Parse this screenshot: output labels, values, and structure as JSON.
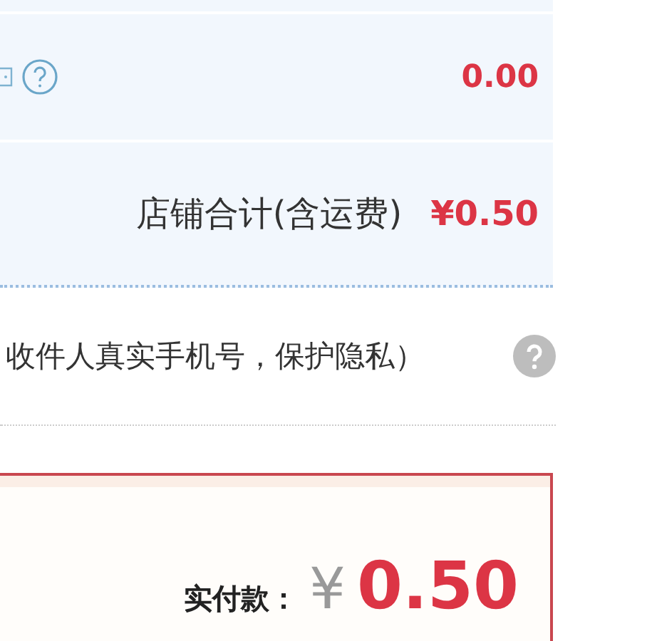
{
  "discount_row": {
    "value": "0.00"
  },
  "shop_total": {
    "label": "店铺合计(含运费)",
    "amount": "¥0.50"
  },
  "privacy_row": {
    "text": "收件人真实手机号，保护隐私）"
  },
  "payment": {
    "label": "实付款：",
    "currency": "¥",
    "amount": "0.50"
  }
}
